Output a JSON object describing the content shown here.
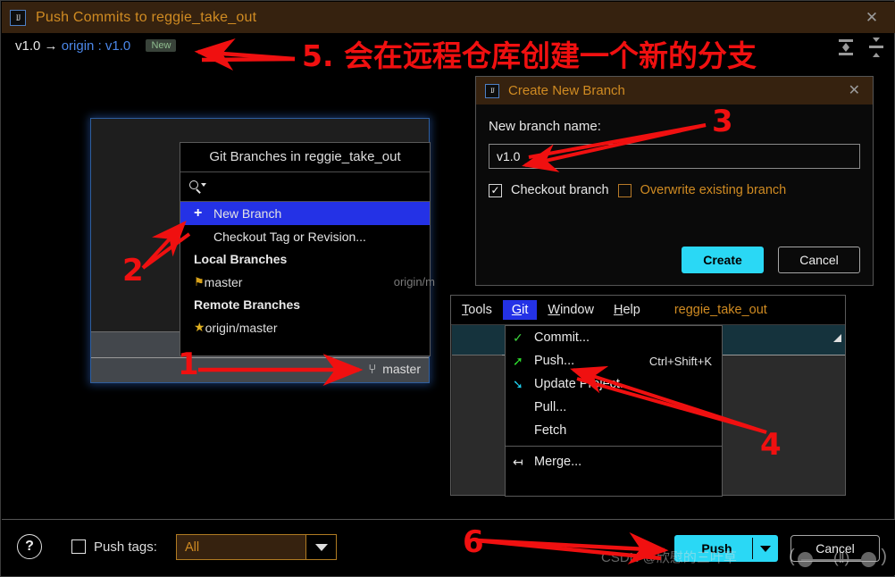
{
  "window": {
    "title": "Push Commits to reggie_take_out",
    "app_icon": "intellij-idea-icon",
    "close_icon": "✕"
  },
  "branch_summary": {
    "local": "v1.0",
    "arrow": "→",
    "remote_prefix": "origin",
    "separator": ":",
    "remote": "v1.0",
    "badge": "New"
  },
  "header_icons": {
    "expand_all": "expand-all-icon",
    "collapse_all": "collapse-all-icon"
  },
  "commit_panel": {
    "current_branch": "master",
    "branch_glyph": "⑂"
  },
  "branches_popup": {
    "title": "Git Branches in reggie_take_out",
    "search_placeholder": "",
    "actions": [
      {
        "label": "New Branch",
        "icon": "plus-icon",
        "selected": true
      },
      {
        "label": "Checkout Tag or Revision...",
        "icon": "",
        "selected": false
      }
    ],
    "local_header": "Local Branches",
    "local_branches": [
      {
        "name": "master",
        "icon": "tag-icon",
        "tracking": "origin/m"
      }
    ],
    "remote_header": "Remote Branches",
    "remote_branches": [
      {
        "name": "origin/master",
        "icon": "star-icon"
      }
    ]
  },
  "create_branch_dialog": {
    "title": "Create New Branch",
    "app_icon": "intellij-idea-icon",
    "close_icon": "✕",
    "field_label": "New branch name:",
    "field_value": "v1.0",
    "checkout_branch": {
      "label": "Checkout branch",
      "checked": true,
      "mark": "✓"
    },
    "overwrite_branch": {
      "label": "Overwrite existing branch",
      "checked": false
    },
    "create_label": "Create",
    "cancel_label": "Cancel"
  },
  "ide": {
    "menubar": [
      {
        "label": "Tools",
        "mnemonic": "T",
        "active": false
      },
      {
        "label": "Git",
        "mnemonic": "G",
        "active": true
      },
      {
        "label": "Window",
        "mnemonic": "W",
        "active": false
      },
      {
        "label": "Help",
        "mnemonic": "H",
        "active": false
      }
    ],
    "project_name": "reggie_take_out",
    "git_menu": [
      {
        "label": "Commit...",
        "icon": "check-icon",
        "shortcut": ""
      },
      {
        "label": "Push...",
        "icon": "arrow-up-right-icon",
        "shortcut": "Ctrl+Shift+K"
      },
      {
        "label": "Update Project...",
        "icon": "arrow-down-left-icon",
        "shortcut": ""
      },
      {
        "label": "Pull...",
        "icon": "",
        "shortcut": ""
      },
      {
        "label": "Fetch",
        "icon": "",
        "shortcut": ""
      },
      {
        "label": "Merge...",
        "icon": "merge-icon",
        "shortcut": ""
      }
    ]
  },
  "footer": {
    "help_label": "?",
    "push_tags_label": "Push tags:",
    "push_tags_checked": false,
    "push_tags_value": "All",
    "push_tags_options": [
      "All"
    ],
    "push_label": "Push",
    "cancel_label": "Cancel"
  },
  "watermark": {
    "text": "CSDN @欣慰的三叶草"
  },
  "annotations": [
    {
      "id": "1",
      "text": "1"
    },
    {
      "id": "2",
      "text": "2"
    },
    {
      "id": "3",
      "text": "3"
    },
    {
      "id": "4",
      "text": "4"
    },
    {
      "id": "5",
      "text": "5. 会在远程仓库创建一个新的分支"
    },
    {
      "id": "6",
      "text": "6"
    }
  ],
  "colors": {
    "accent_orange": "#d08b22",
    "titlebar_brown": "#36220f",
    "select_blue": "#2432e6",
    "primary_cyan": "#2ad8f5",
    "annotation_red": "#f01010",
    "badge_green": "#8fbd8f"
  }
}
